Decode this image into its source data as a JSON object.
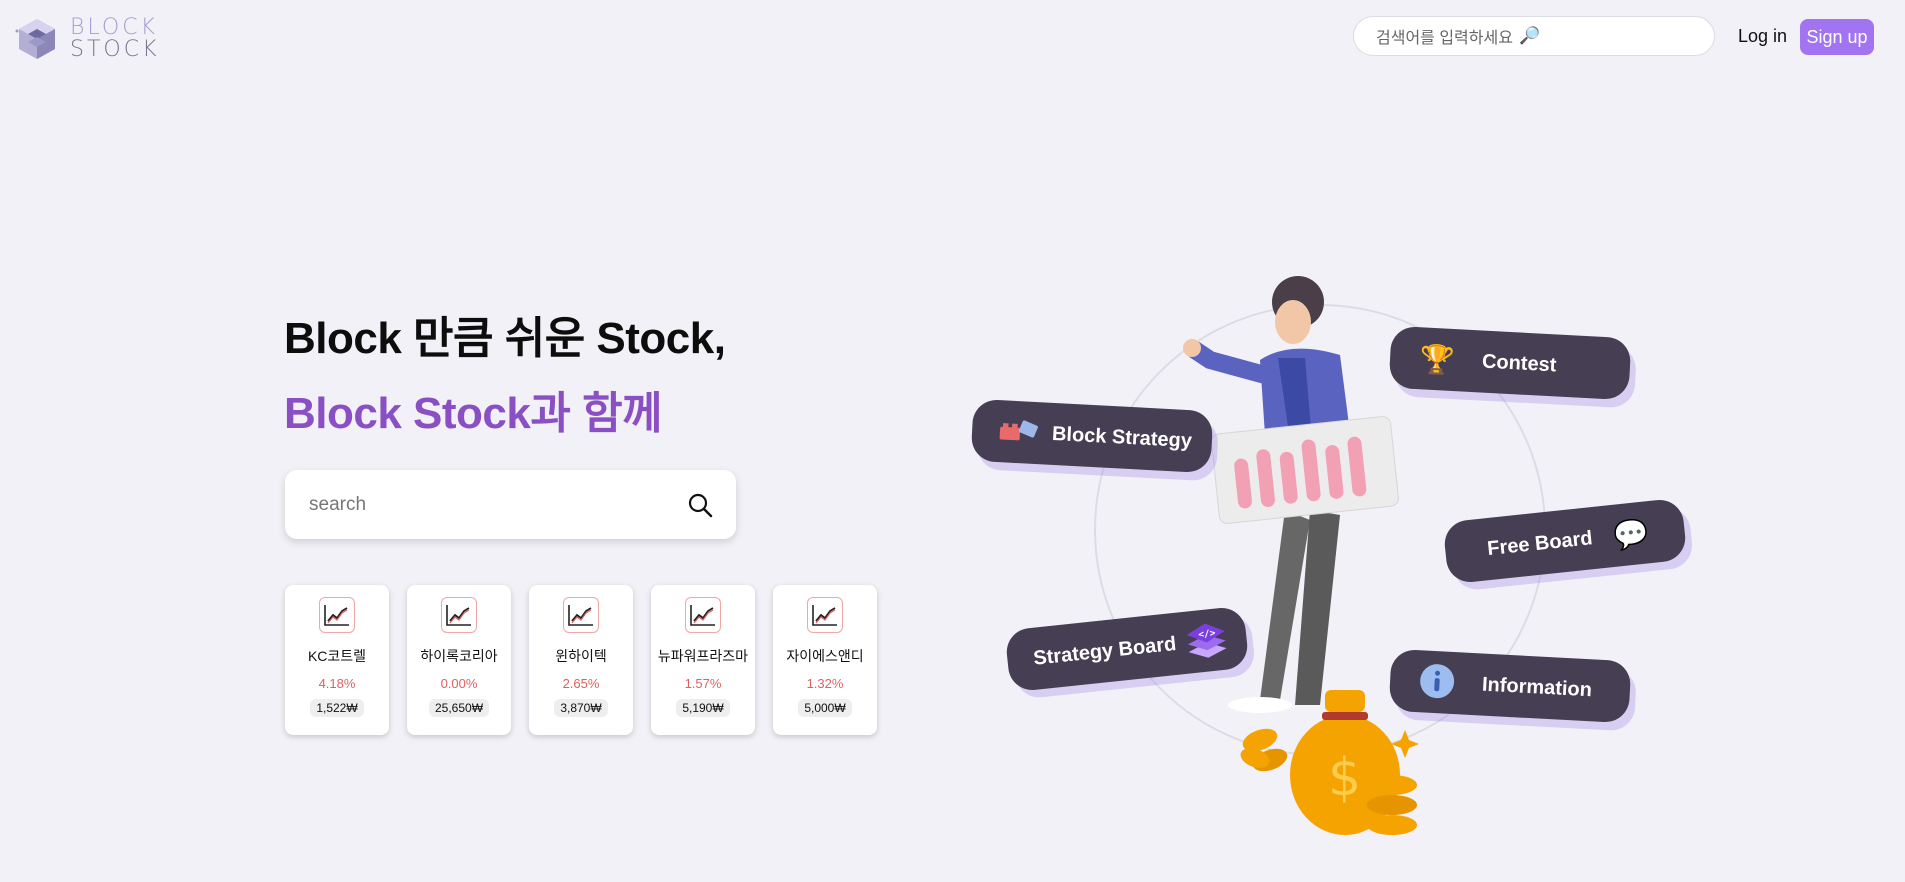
{
  "header": {
    "logo_line1": "BLOCK",
    "logo_line2": "STOCK",
    "search_placeholder": "검색어를 입력하세요",
    "search_icon": "magnifier-icon",
    "login_label": "Log in",
    "signup_label": "Sign up"
  },
  "hero": {
    "title_line1": "Block 만큼 쉬운 Stock,",
    "title_line2": "Block Stock과 함께",
    "search_placeholder": "search"
  },
  "stocks": [
    {
      "name": "KC코트렐",
      "change": "4.18%",
      "price": "1,522₩"
    },
    {
      "name": "하이록코리아",
      "change": "0.00%",
      "price": "25,650₩"
    },
    {
      "name": "윈하이텍",
      "change": "2.65%",
      "price": "3,870₩"
    },
    {
      "name": "뉴파워프라즈마",
      "change": "1.57%",
      "price": "5,190₩"
    },
    {
      "name": "자이에스앤디",
      "change": "1.32%",
      "price": "5,000₩"
    }
  ],
  "menu": {
    "block_strategy": "Block Strategy",
    "contest": "Contest",
    "free_board": "Free Board",
    "strategy_board": "Strategy Board",
    "information": "Information"
  },
  "colors": {
    "background": "#f1f1f7",
    "accent": "#a374f2",
    "title_purple": "#8b4fc4",
    "pill": "#463e52",
    "change_red": "#e06060"
  }
}
